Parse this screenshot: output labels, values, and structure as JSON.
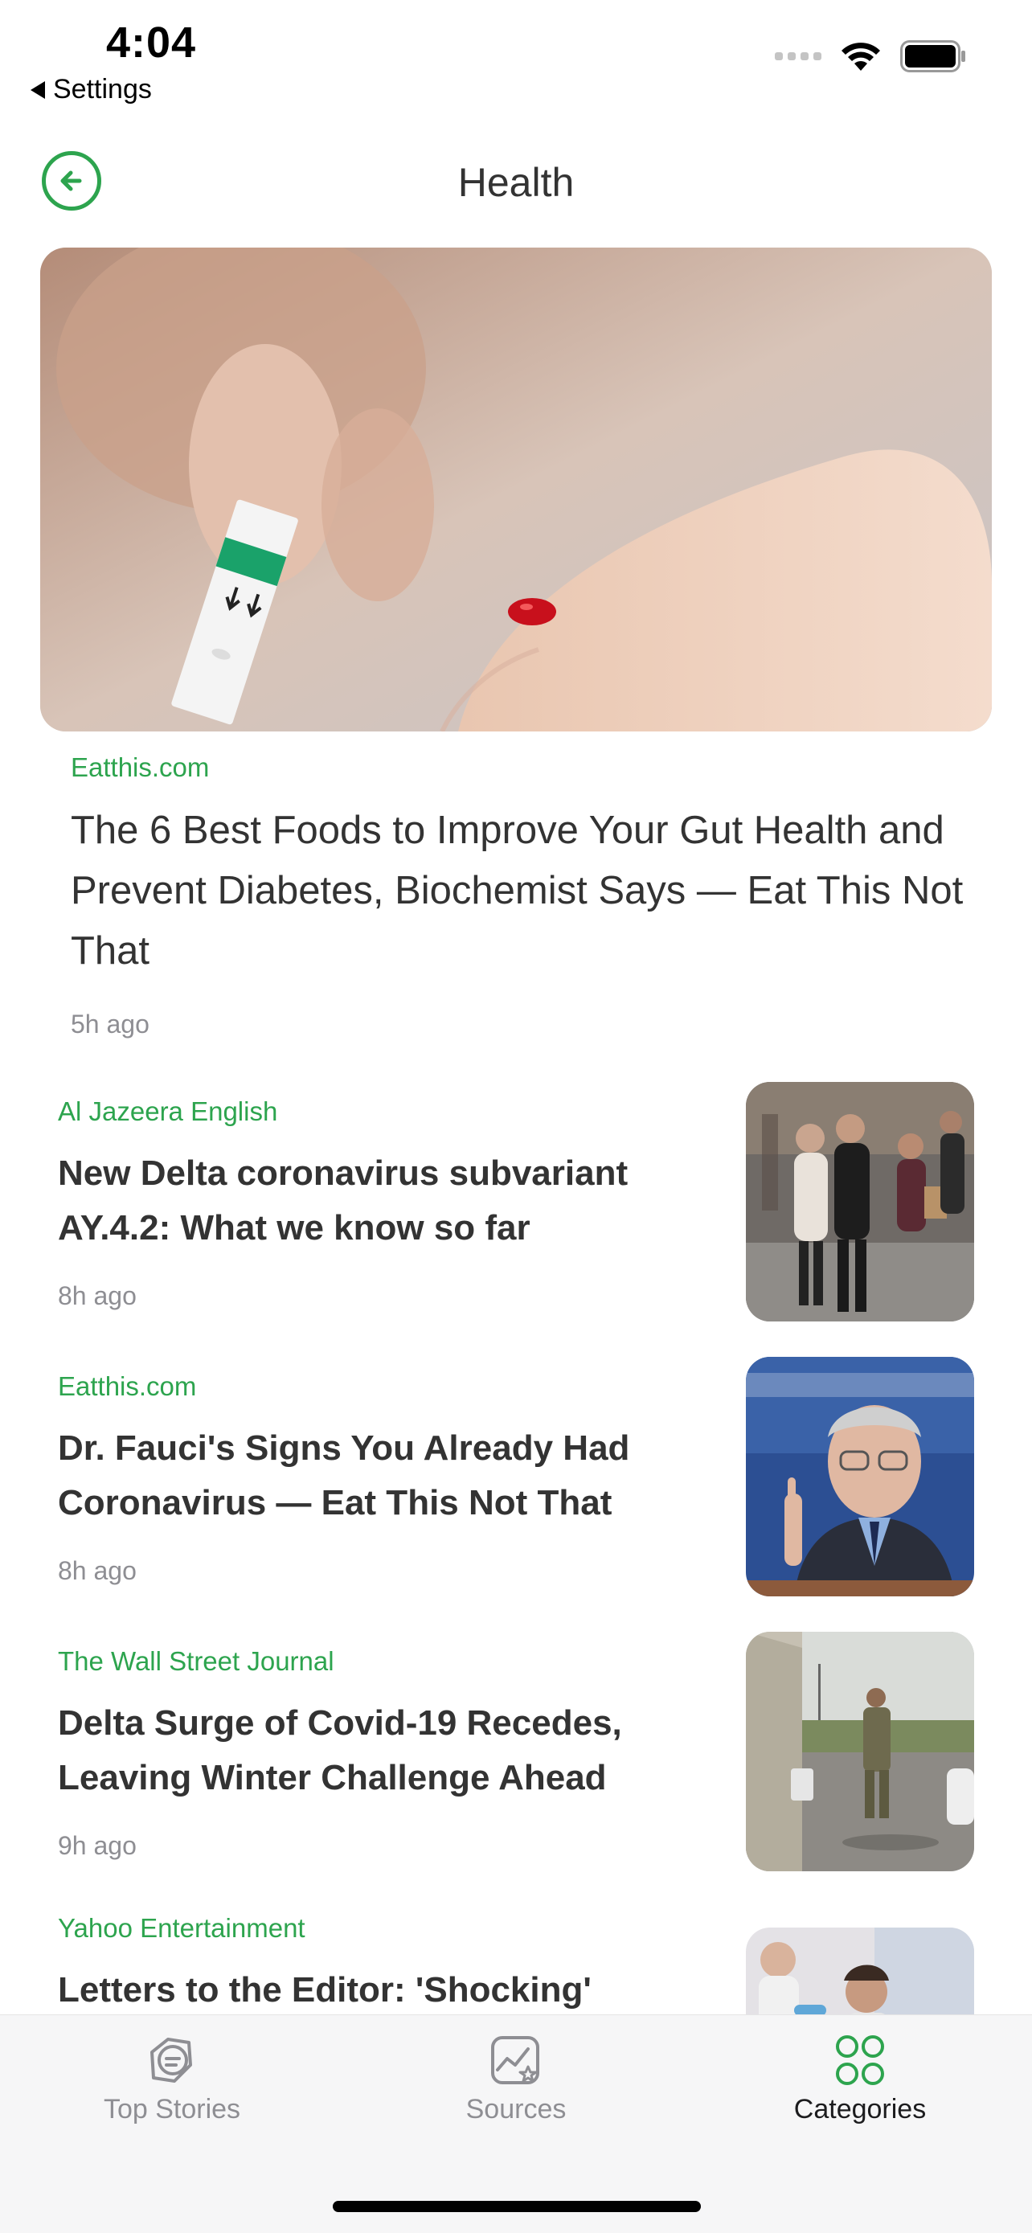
{
  "status_bar": {
    "time": "4:04",
    "back_label": "Settings"
  },
  "nav": {
    "title": "Health"
  },
  "hero": {
    "source": "Eatthis.com",
    "title": "The 6 Best Foods to Improve Your Gut Health and Prevent Diabetes, Biochemist Says — Eat This Not That",
    "time": "5h ago"
  },
  "articles": [
    {
      "source": "Al Jazeera English",
      "title": "New Delta coronavirus subvariant AY.4.2: What we know so far",
      "time": "8h ago"
    },
    {
      "source": "Eatthis.com",
      "title": "Dr. Fauci's Signs You Already Had Coronavirus — Eat This Not That",
      "time": "8h ago"
    },
    {
      "source": "The Wall Street Journal",
      "title": "Delta Surge of Covid-19 Recedes, Leaving Winter Challenge Ahead",
      "time": "9h ago"
    },
    {
      "source": "Yahoo Entertainment",
      "title": "Letters to the Editor: 'Shocking'",
      "time": ""
    }
  ],
  "tabs": [
    {
      "label": "Top Stories",
      "icon": "top-stories-icon",
      "active": false
    },
    {
      "label": "Sources",
      "icon": "sources-icon",
      "active": false
    },
    {
      "label": "Categories",
      "icon": "categories-icon",
      "active": true
    }
  ],
  "colors": {
    "accent": "#2da44e",
    "text": "#333333",
    "muted": "#8e8e93",
    "tabbar_bg": "#f6f6f7"
  }
}
